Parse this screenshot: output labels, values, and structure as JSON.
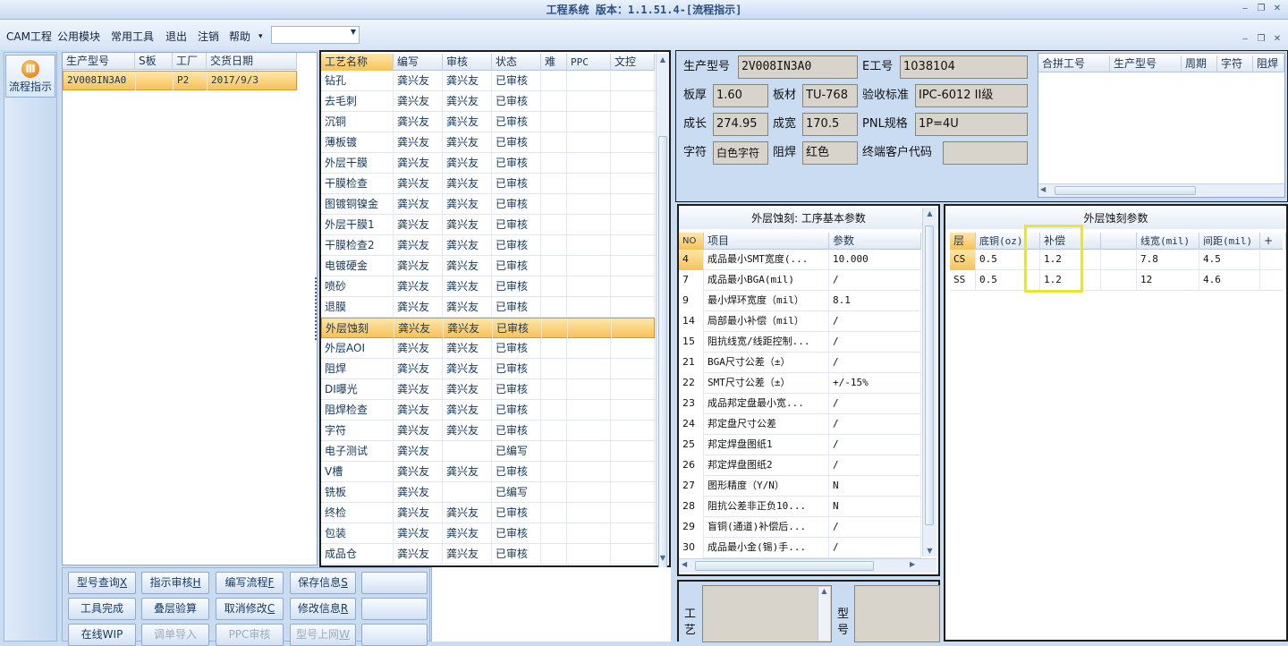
{
  "window": {
    "title": "工程系统 版本：1.1.51.4-[流程指示]",
    "min": "‒",
    "restore": "❐",
    "close": "✕",
    "mdi_min": "‒",
    "mdi_restore": "❐",
    "mdi_close": "✕"
  },
  "menu": [
    "CAM工程",
    "公用模块",
    "常用工具",
    "退出",
    "注销",
    "帮助"
  ],
  "menu_more": "▾",
  "combo": {
    "value": "",
    "arrow": "▼"
  },
  "side": {
    "btn_label": "流程指示",
    "btn_icon": "Ⅲ"
  },
  "orders": {
    "columns": [
      "生产型号",
      "S板",
      "工厂",
      "交货日期"
    ],
    "rows": [
      [
        "2V008IN3A0",
        "",
        "P2",
        "2017/9/3"
      ]
    ]
  },
  "process": {
    "columns": [
      "工艺名称",
      "编写",
      "审核",
      "状态",
      "难",
      "PPC",
      "文控"
    ],
    "rows": [
      [
        "钻孔",
        "龚兴友",
        "龚兴友",
        "已审核"
      ],
      [
        "去毛刺",
        "龚兴友",
        "龚兴友",
        "已审核"
      ],
      [
        "沉铜",
        "龚兴友",
        "龚兴友",
        "已审核"
      ],
      [
        "薄板镀",
        "龚兴友",
        "龚兴友",
        "已审核"
      ],
      [
        "外层干膜",
        "龚兴友",
        "龚兴友",
        "已审核"
      ],
      [
        "干膜检查",
        "龚兴友",
        "龚兴友",
        "已审核"
      ],
      [
        "图镀铜镍金",
        "龚兴友",
        "龚兴友",
        "已审核"
      ],
      [
        "外层干膜1",
        "龚兴友",
        "龚兴友",
        "已审核"
      ],
      [
        "干膜检查2",
        "龚兴友",
        "龚兴友",
        "已审核"
      ],
      [
        "电镀硬金",
        "龚兴友",
        "龚兴友",
        "已审核"
      ],
      [
        "喷砂",
        "龚兴友",
        "龚兴友",
        "已审核"
      ],
      [
        "退膜",
        "龚兴友",
        "龚兴友",
        "已审核"
      ],
      [
        "外层蚀刻",
        "龚兴友",
        "龚兴友",
        "已审核"
      ],
      [
        "外层AOI",
        "龚兴友",
        "龚兴友",
        "已审核"
      ],
      [
        "阻焊",
        "龚兴友",
        "龚兴友",
        "已审核"
      ],
      [
        "DI曝光",
        "龚兴友",
        "龚兴友",
        "已审核"
      ],
      [
        "阻焊检查",
        "龚兴友",
        "龚兴友",
        "已审核"
      ],
      [
        "字符",
        "龚兴友",
        "龚兴友",
        "已审核"
      ],
      [
        "电子测试",
        "龚兴友",
        "",
        "已编写"
      ],
      [
        "V槽",
        "龚兴友",
        "龚兴友",
        "已审核"
      ],
      [
        "铣板",
        "龚兴友",
        "",
        "已编写"
      ],
      [
        "终检",
        "龚兴友",
        "龚兴友",
        "已审核"
      ],
      [
        "包装",
        "龚兴友",
        "龚兴友",
        "已审核"
      ],
      [
        "成品仓",
        "龚兴友",
        "龚兴友",
        "已审核"
      ]
    ],
    "selected_index": 12
  },
  "info": {
    "product_model_label": "生产型号",
    "product_model": "2V008IN3A0",
    "e_job_label": "E工号",
    "e_job": "1038104",
    "thickness_label": "板厚",
    "thickness": "1.60",
    "material_label": "板材",
    "material": "TU-768",
    "standard_label": "验收标准",
    "standard": "IPC-6012 II级",
    "length_label": "成长",
    "length": "274.95",
    "width_label": "成宽",
    "width": "170.5",
    "pnl_label": "PNL规格",
    "pnl": "1P=4U",
    "char_label": "字符",
    "char": "白色字符",
    "mask_label": "阻焊",
    "mask": "红色",
    "customer_code_label": "终端客户代码",
    "customer_code": ""
  },
  "merge": {
    "columns": [
      "合拼工号",
      "生产型号",
      "周期",
      "字符",
      "阻焊"
    ]
  },
  "params": {
    "title": "外层蚀刻: 工序基本参数",
    "columns": [
      "NO",
      "项目",
      "参数"
    ],
    "rows": [
      [
        "4",
        "成品最小SMT宽度(...",
        "10.000"
      ],
      [
        "7",
        "成品最小BGA(mil)",
        "/"
      ],
      [
        "9",
        "最小焊环宽度（mil）",
        "8.1"
      ],
      [
        "14",
        "局部最小补偿（mil）",
        "/"
      ],
      [
        "15",
        "阻抗线宽/线距控制...",
        "/"
      ],
      [
        "21",
        "BGA尺寸公差（±）",
        "/"
      ],
      [
        "22",
        "SMT尺寸公差（±）",
        "+/-15%"
      ],
      [
        "23",
        "成品邦定盘最小宽...",
        "/"
      ],
      [
        "24",
        "邦定盘尺寸公差",
        "/"
      ],
      [
        "25",
        "邦定焊盘图纸1",
        "/"
      ],
      [
        "26",
        "邦定焊盘图纸2",
        "/"
      ],
      [
        "27",
        "图形精度（Y/N）",
        "N"
      ],
      [
        "28",
        "阻抗公差非正负10...",
        "N"
      ],
      [
        "29",
        "盲铜(通道)补偿后...",
        "/"
      ],
      [
        "30",
        "成品最小金(锡)手...",
        "/"
      ]
    ]
  },
  "etch": {
    "title": "外层蚀刻参数",
    "columns": [
      "层",
      "底铜(oz)",
      "补偿",
      "",
      "线宽(mil)",
      "间距(mil)",
      "+",
      "-"
    ],
    "rows": [
      [
        "CS",
        "0.5",
        "1.2",
        "",
        "7.8",
        "4.5",
        "",
        ""
      ],
      [
        "SS",
        "0.5",
        "1.2",
        "",
        "12",
        "4.6",
        "",
        ""
      ]
    ]
  },
  "buttons": [
    {
      "label": "型号查询",
      "key": "X",
      "disabled": false
    },
    {
      "label": "指示审核",
      "key": "H",
      "disabled": false
    },
    {
      "label": "编写流程",
      "key": "F",
      "disabled": false
    },
    {
      "label": "保存信息",
      "key": "S",
      "disabled": false
    },
    {
      "label": "",
      "key": "",
      "disabled": false
    },
    {
      "label": "工具完成",
      "key": "",
      "disabled": false
    },
    {
      "label": "叠层验算",
      "key": "",
      "disabled": false
    },
    {
      "label": "取消修改",
      "key": "C",
      "disabled": false
    },
    {
      "label": "修改信息",
      "key": "R",
      "disabled": false
    },
    {
      "label": "",
      "key": "",
      "disabled": false
    },
    {
      "label": "在线WIP",
      "key": "",
      "disabled": false
    },
    {
      "label": "调单导入",
      "key": "",
      "disabled": true
    },
    {
      "label": "PPC审核",
      "key": "",
      "disabled": true
    },
    {
      "label": "型号上网",
      "key": "W",
      "disabled": true
    },
    {
      "label": "",
      "key": "",
      "disabled": false
    }
  ],
  "bottom": {
    "craft_label": "工艺",
    "model_label": "型号"
  }
}
